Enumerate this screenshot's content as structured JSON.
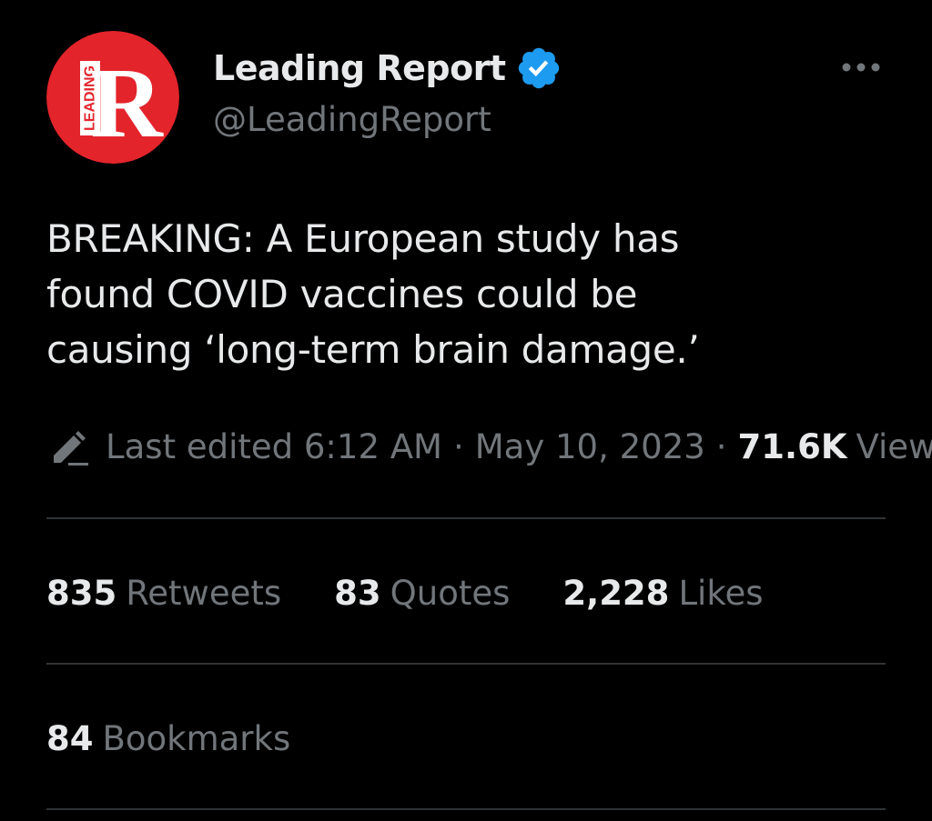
{
  "colors": {
    "background": "#000000",
    "primary_text": "#e7e9ea",
    "secondary_text": "#71767b",
    "divider": "#2f3336",
    "verified_badge": "#1d9bf0",
    "avatar_red": "#e3242b"
  },
  "author": {
    "display_name": "Leading Report",
    "handle": "@LeadingReport",
    "verified": true,
    "avatar": {
      "letter": "R",
      "side_text": "LEADING"
    }
  },
  "icons": {
    "more": "more-horizontal-icon",
    "verified": "verified-badge-icon",
    "edited": "pencil-icon"
  },
  "tweet": {
    "text": "BREAKING: A European study has\nfound COVID vaccines could be\ncausing ‘long-term brain damage.’"
  },
  "meta": {
    "edited_label": "Last edited",
    "time": "6:12 AM",
    "separator": "·",
    "date": "May 10, 2023",
    "views_count": "71.6K",
    "views_label": "Views"
  },
  "stats": {
    "retweets": {
      "count": "835",
      "label": "Retweets"
    },
    "quotes": {
      "count": "83",
      "label": "Quotes"
    },
    "likes": {
      "count": "2,228",
      "label": "Likes"
    },
    "bookmarks": {
      "count": "84",
      "label": "Bookmarks"
    }
  }
}
